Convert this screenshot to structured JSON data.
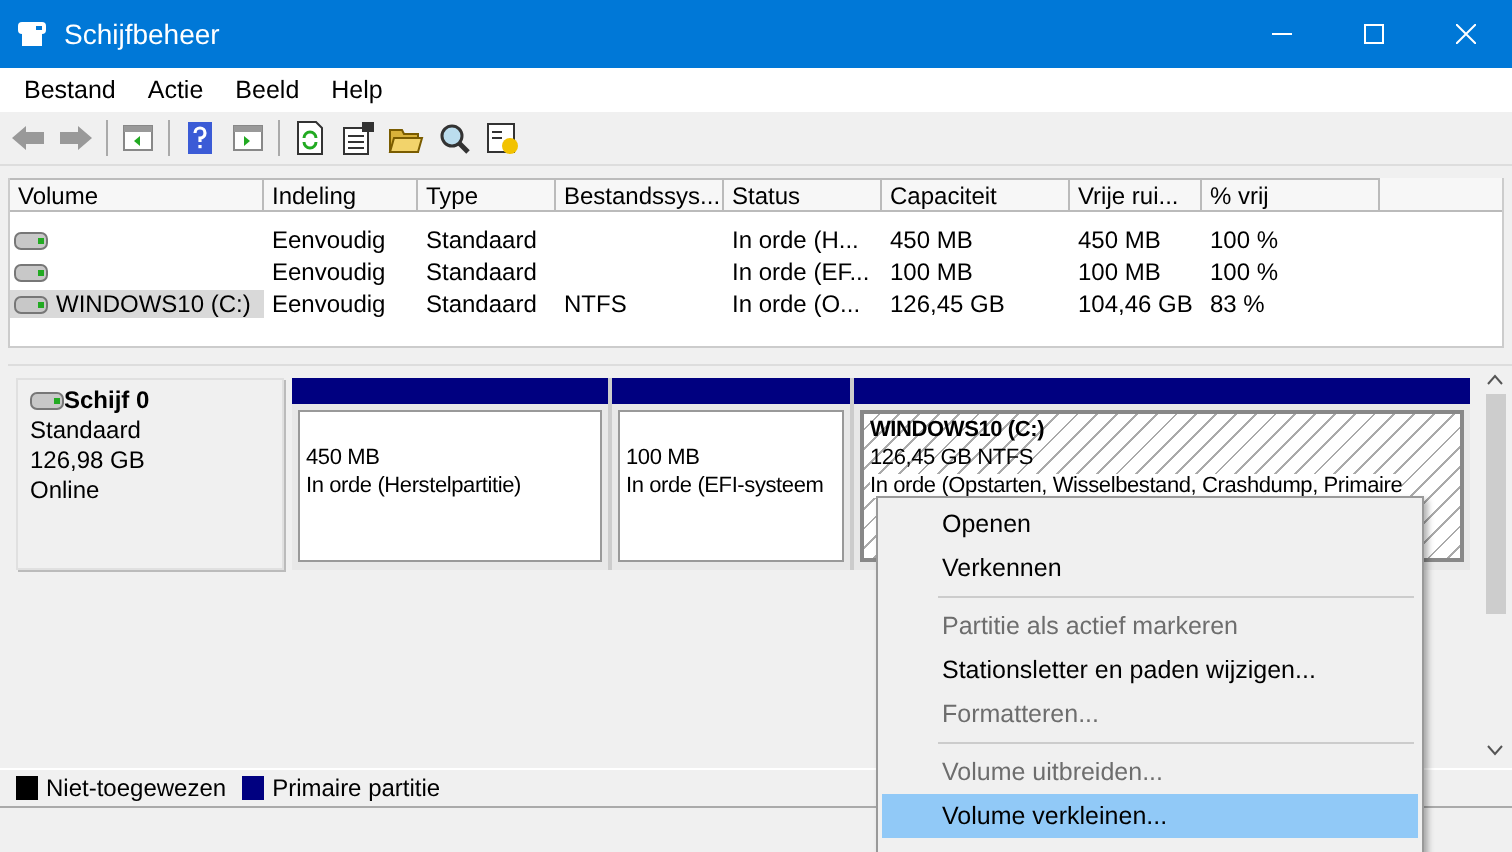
{
  "window": {
    "title": "Schijfbeheer"
  },
  "menu_bar": [
    "Bestand",
    "Actie",
    "Beeld",
    "Help"
  ],
  "volume_table": {
    "columns": [
      "Volume",
      "Indeling",
      "Type",
      "Bestandssys...",
      "Status",
      "Capaciteit",
      "Vrije rui...",
      "% vrij"
    ],
    "rows": [
      {
        "selected": false,
        "cells": [
          "",
          "Eenvoudig",
          "Standaard",
          "",
          "In orde (H...",
          "450 MB",
          "450 MB",
          "100 %"
        ]
      },
      {
        "selected": false,
        "cells": [
          "",
          "Eenvoudig",
          "Standaard",
          "",
          "In orde (EF...",
          "100 MB",
          "100 MB",
          "100 %"
        ]
      },
      {
        "selected": true,
        "cells": [
          "WINDOWS10 (C:)",
          "Eenvoudig",
          "Standaard",
          "NTFS",
          "In orde (O...",
          "126,45 GB",
          "104,46 GB",
          "83 %"
        ]
      }
    ]
  },
  "disk": {
    "name": "Schijf 0",
    "type": "Standaard",
    "size": "126,98 GB",
    "state": "Online",
    "partitions": [
      {
        "selected": false,
        "size": "450 MB",
        "status": "In orde (Herstelpartitie)"
      },
      {
        "selected": false,
        "size": "100 MB",
        "status": "In orde (EFI-systeem"
      },
      {
        "selected": true,
        "label": "WINDOWS10  (C:)",
        "size": "126,45 GB NTFS",
        "status": "In orde (Opstarten, Wisselbestand, Crashdump, Primaire"
      }
    ]
  },
  "legend": [
    {
      "label": "Niet-toegewezen",
      "color": "#000000"
    },
    {
      "label": "Primaire partitie",
      "color": "#000080"
    }
  ],
  "context_menu": [
    {
      "kind": "item",
      "label": "Openen",
      "disabled": false,
      "selected": false
    },
    {
      "kind": "item",
      "label": "Verkennen",
      "disabled": false,
      "selected": false
    },
    {
      "kind": "separator"
    },
    {
      "kind": "item",
      "label": "Partitie als actief markeren",
      "disabled": true,
      "selected": false
    },
    {
      "kind": "item",
      "label": "Stationsletter en paden wijzigen...",
      "disabled": false,
      "selected": false
    },
    {
      "kind": "item",
      "label": "Formatteren...",
      "disabled": true,
      "selected": false
    },
    {
      "kind": "separator"
    },
    {
      "kind": "item",
      "label": "Volume uitbreiden...",
      "disabled": true,
      "selected": false
    },
    {
      "kind": "item",
      "label": "Volume verkleinen...",
      "disabled": false,
      "selected": true
    }
  ]
}
